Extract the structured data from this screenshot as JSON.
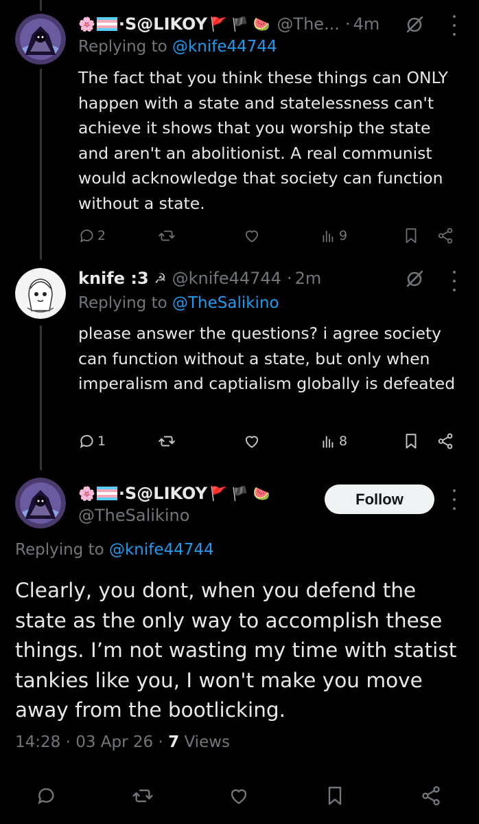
{
  "tweet1": {
    "display_name": "·S@LIKOY",
    "prefix_emojis": "🌸",
    "suffix_emojis": "🚩 🏴 🍉",
    "handle": "@The...",
    "time": "4m",
    "replying_label": "Replying to",
    "replying_handle": "@knife44744",
    "body": "The fact that you think these things can ONLY happen with a state and statelessness can't achieve it shows that you worship the state and aren't an abolitionist. A real communist would acknowledge that society can function without a state.",
    "replies": "2",
    "views": "9"
  },
  "tweet2": {
    "display_name": "knife :3",
    "name_emoji": "☭",
    "handle": "@knife44744",
    "time": "2m",
    "replying_label": "Replying to",
    "replying_handle": "@TheSalikino",
    "body": "please answer the questions? i agree society can function without a state, but only when imperalism and captialism globally is defeated",
    "replies": "1",
    "views": "8"
  },
  "main": {
    "display_name": "·S@LIKOY",
    "prefix_emojis": "🌸",
    "suffix_emojis": "🚩 🏴 🍉",
    "handle": "@TheSalikino",
    "follow_label": "Follow",
    "replying_label": "Replying to",
    "replying_handle": "@knife44744",
    "body": "Clearly, you dont, when you defend the state as the only way to accomplish these things. I’m not wasting my time with statist tankies like you, I won't make you move away from the bootlicking.",
    "time": "14:28",
    "date": "03 Apr 26",
    "views_count": "7",
    "views_label": "Views"
  },
  "separator": "·",
  "colors": {
    "background": "#000000",
    "text": "#e7e9ea",
    "muted": "#71767b",
    "link": "#1d9bf0"
  }
}
